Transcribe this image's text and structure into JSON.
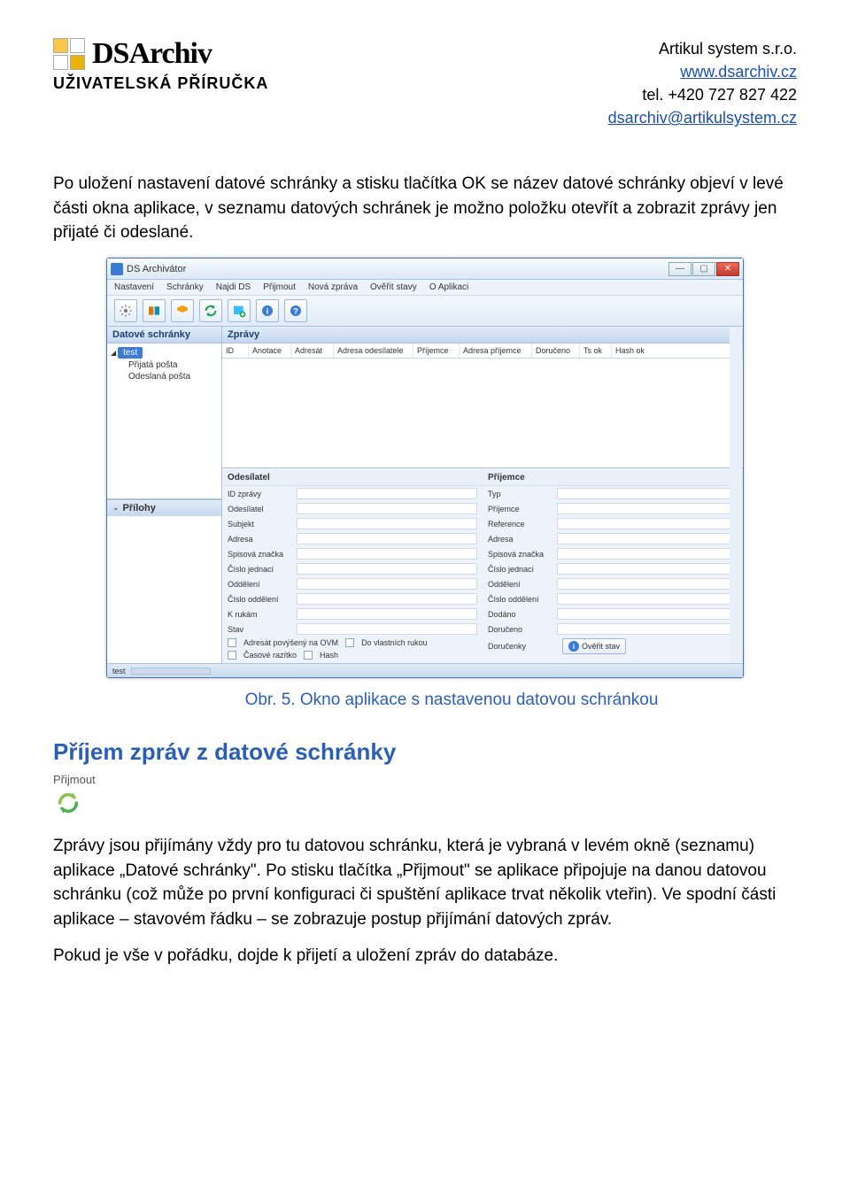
{
  "header": {
    "logo_text": "DSArchiv",
    "subtitle": "UŽIVATELSKÁ PŘÍRUČKA",
    "company": "Artikul system s.r.o.",
    "website": "www.dsarchiv.cz",
    "tel": "tel. +420 727 827 422",
    "email": "dsarchiv@artikulsystem.cz"
  },
  "paragraphs": {
    "p1": "Po uložení nastavení datové schránky a stisku tlačítka OK se název datové schránky objeví v levé části okna aplikace, v seznamu datových schránek je možno položku otevřít a zobrazit zprávy jen přijaté či odeslané.",
    "caption": "Obr. 5. Okno aplikace s nastavenou datovou schránkou",
    "h2": "Příjem zpráv z datové schránky",
    "prijmout_label": "Přijmout",
    "p2": "Zprávy jsou přijímány vždy pro tu datovou schránku, která je vybraná v levém okně (seznamu) aplikace „Datové schránky\". Po stisku tlačítka „Přijmout\" se aplikace připojuje na danou datovou schránku (což může po první konfiguraci či spuštění aplikace trvat několik vteřin). Ve spodní části aplikace – stavovém řádku – se zobrazuje postup přijímání datových zpráv.",
    "p3": "Pokud je vše v pořádku, dojde k přijetí a uložení zpráv do databáze."
  },
  "app": {
    "title": "DS Archivátor",
    "menu": [
      "Nastavení",
      "Schránky",
      "Najdi DS",
      "Přijmout",
      "Nová zpráva",
      "Ověřit stavy",
      "O Aplikaci"
    ],
    "sidebar": {
      "panel_title": "Datové schránky",
      "tree_root": "test",
      "tree_children": [
        "Přijatá pošta",
        "Odeslaná pošta"
      ],
      "attachments_title": "Přílohy"
    },
    "messages_panel_title": "Zprávy",
    "grid_cols": [
      "ID",
      "Anotace",
      "Adresát",
      "Adresa odesílatele",
      "Příjemce",
      "Adresa příjemce",
      "Doručeno",
      "Ts ok",
      "Hash ok"
    ],
    "sender": {
      "title": "Odesílatel",
      "rows": [
        "ID zprávy",
        "Odesílatel",
        "Subjekt",
        "Adresa",
        "Spisová značka",
        "Číslo jednací",
        "Oddělení",
        "Číslo oddělení",
        "K rukám",
        "Stav"
      ],
      "chk1": "Adresát povýšený na OVM",
      "chk2": "Do vlastních rukou",
      "chk3": "Časové razítko",
      "chk4": "Hash"
    },
    "recipient": {
      "title": "Příjemce",
      "rows": [
        "Typ",
        "Příjemce",
        "Reference",
        "Adresa",
        "Spisová značka",
        "Číslo jednací",
        "Oddělení",
        "Číslo oddělení",
        "Dodáno",
        "Doručeno"
      ],
      "delivery_label": "Doručenky",
      "verify_btn": "Ověřit stav"
    },
    "statusbar": "test"
  }
}
